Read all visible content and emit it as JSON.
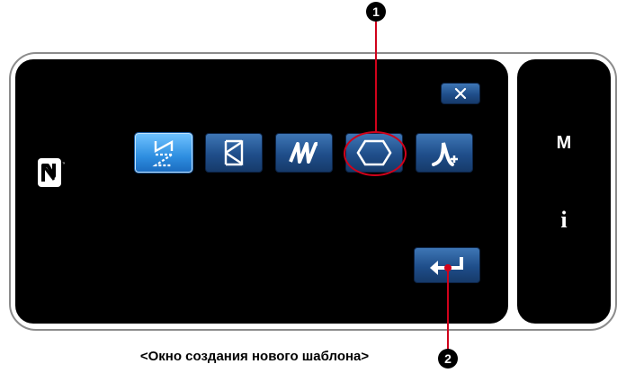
{
  "caption": "<Окно создания нового шаблона>",
  "markers": [
    "1",
    "2"
  ],
  "side_panel": {
    "menu_label": "M",
    "info_label": "i"
  },
  "toolbar": {
    "close_icon": "x-icon",
    "enter_icon": "enter-arrow-icon"
  },
  "pattern_types": [
    {
      "icon": "zigzag-dashed-icon",
      "active": true
    },
    {
      "icon": "zigzag-icon",
      "active": false
    },
    {
      "icon": "multi-zigzag-icon",
      "active": false
    },
    {
      "icon": "hexagon-icon",
      "active": false
    },
    {
      "icon": "curve-add-icon",
      "active": false
    }
  ],
  "colors": {
    "button_blue": "#1f4e8a",
    "active_blue": "#2e8ee0",
    "callout_red": "#d0021b",
    "screen_black": "#000000"
  }
}
